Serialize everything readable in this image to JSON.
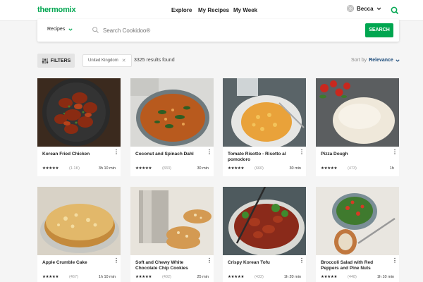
{
  "header": {
    "logo": "thermomix",
    "nav": [
      "Explore",
      "My Recipes",
      "My Week"
    ],
    "user": "Becca"
  },
  "search": {
    "category": "Recipes",
    "placeholder": "Search Cookidoo®",
    "button": "SEARCH"
  },
  "filters": {
    "label": "FILTERS",
    "chip": "United Kingdom",
    "results": "3325 results found",
    "sort_label": "Sort by",
    "sort_value": "Relevance"
  },
  "recipes": [
    {
      "title": "Korean Fried Chicken",
      "stars": "★★★★★",
      "count": "(1.1K)",
      "time": "3h 10 min"
    },
    {
      "title": "Coconut and Spinach Dahl",
      "stars": "★★★★★",
      "count": "(833)",
      "time": "30 min"
    },
    {
      "title": "Tomato Risotto - Risotto al pomodoro",
      "stars": "★★★★★",
      "count": "(660)",
      "time": "30 min"
    },
    {
      "title": "Pizza Dough",
      "stars": "★★★★★",
      "count": "(473)",
      "time": "1h"
    },
    {
      "title": "Apple Crumble Cake",
      "stars": "★★★★★",
      "count": "(467)",
      "time": "1h 10 min"
    },
    {
      "title": "Soft and Chewy White Chocolate Chip Cookies",
      "stars": "★★★★★",
      "count": "(402)",
      "time": "25 min"
    },
    {
      "title": "Crispy Korean Tofu",
      "stars": "★★★★★",
      "count": "(432)",
      "time": "1h 20 min"
    },
    {
      "title": "Broccoli Salad with Red Peppers and Pine Nuts",
      "stars": "★★★★★",
      "count": "(448)",
      "time": "1h 10 min"
    }
  ],
  "colors": {
    "brand": "#00a650",
    "background": "#f5f5f5"
  }
}
